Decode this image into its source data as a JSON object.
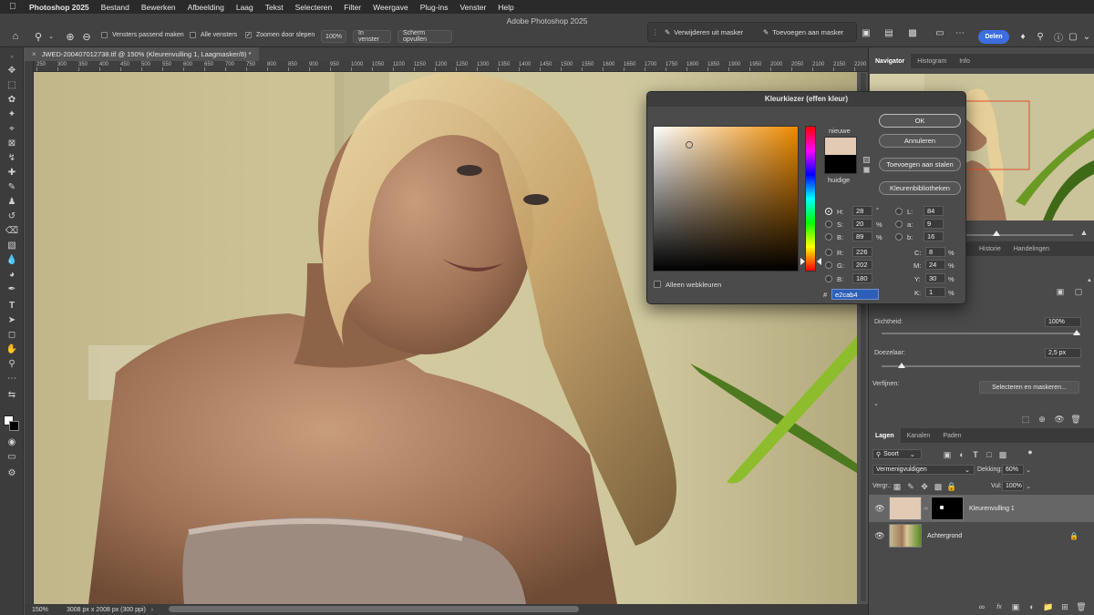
{
  "menubar": {
    "app": "Photoshop 2025",
    "items": [
      "Bestand",
      "Bewerken",
      "Afbeelding",
      "Laag",
      "Tekst",
      "Selecteren",
      "Filter",
      "Weergave",
      "Plug-ins",
      "Venster",
      "Help"
    ]
  },
  "optionsbar": {
    "title": "Adobe Photoshop 2025",
    "fit_windows_label": "Vensters passend maken",
    "all_windows_label": "Alle vensters",
    "scrubby_zoom_label": "Zoomen door slepen",
    "scrubby_zoom_checked": true,
    "zoom_100": "100%",
    "fit_in_window": "In venster",
    "fill_screen": "Scherm opvullen",
    "remove_from_mask": "Verwijderen uit masker",
    "add_to_mask": "Toevoegen aan masker",
    "share": "Delen"
  },
  "document": {
    "tab_title": "JWED-200407012738.tif @ 150% (Kleurenvulling 1, Laagmasker/8) *",
    "ruler_labels": [
      "250",
      "300",
      "350",
      "400",
      "450",
      "500",
      "550",
      "600",
      "650",
      "700",
      "750",
      "800",
      "850",
      "900",
      "950",
      "1000",
      "1050",
      "1100",
      "1150",
      "1200",
      "1250",
      "1300",
      "1350",
      "1400",
      "1450",
      "1500",
      "1550",
      "1600",
      "1650",
      "1700",
      "1750",
      "1800",
      "1850",
      "1900",
      "1950",
      "2000",
      "2050",
      "2100",
      "2150",
      "2200"
    ],
    "zoom": "150%",
    "doc_info": "3008 px x 2008 px (300 ppi)"
  },
  "navigator_panel": {
    "tabs": [
      "Navigator",
      "Histogram",
      "Info"
    ]
  },
  "properties_panel": {
    "tabs": [
      "Historie",
      "Handelingen"
    ],
    "density_label": "Dichtheid:",
    "density_value": "100%",
    "density_level": 1.0,
    "feather_label": "Doezelaar:",
    "feather_value": "2,5 px",
    "feather_level": 0.1,
    "refine_label": "Verfijnen:",
    "select_and_mask": "Selecteren en maskeren..."
  },
  "layers_panel": {
    "tabs": [
      "Lagen",
      "Kanalen",
      "Paden"
    ],
    "filter_kind": "Soort",
    "blend_mode": "Vermenigvuldigen",
    "opacity_label": "Dekking:",
    "opacity_value": "60%",
    "lock_label": "Vergr.:",
    "fill_label": "Vul:",
    "fill_value": "100%",
    "layers": [
      {
        "name": "Kleurenvulling 1",
        "selected": true
      },
      {
        "name": "Achtergrond",
        "selected": false
      }
    ]
  },
  "color_picker": {
    "title": "Kleurkiezer (effen kleur)",
    "new_label": "nieuwe",
    "current_label": "huidige",
    "new_color": "#e2cab4",
    "current_color": "#000000",
    "ok": "OK",
    "cancel": "Annuleren",
    "add_to_swatches": "Toevoegen aan stalen",
    "color_libraries": "Kleurenbibliotheken",
    "web_colors_only": "Alleen webkleuren",
    "hsb": {
      "H": "28",
      "S": "20",
      "B": "89",
      "h_unit": "°",
      "s_unit": "%",
      "b_unit": "%"
    },
    "rgb": {
      "R": "226",
      "G": "202",
      "B": "180"
    },
    "lab": {
      "L": "84",
      "a": "9",
      "b": "16"
    },
    "cmyk": {
      "C": "8",
      "M": "24",
      "Y": "30",
      "K": "1",
      "unit": "%"
    },
    "hex_prefix": "#",
    "hex": "e2cab4"
  },
  "colors": {
    "accent": "#3c6ee0",
    "ui_dark": "#424242",
    "panel": "#4a4a4a"
  }
}
